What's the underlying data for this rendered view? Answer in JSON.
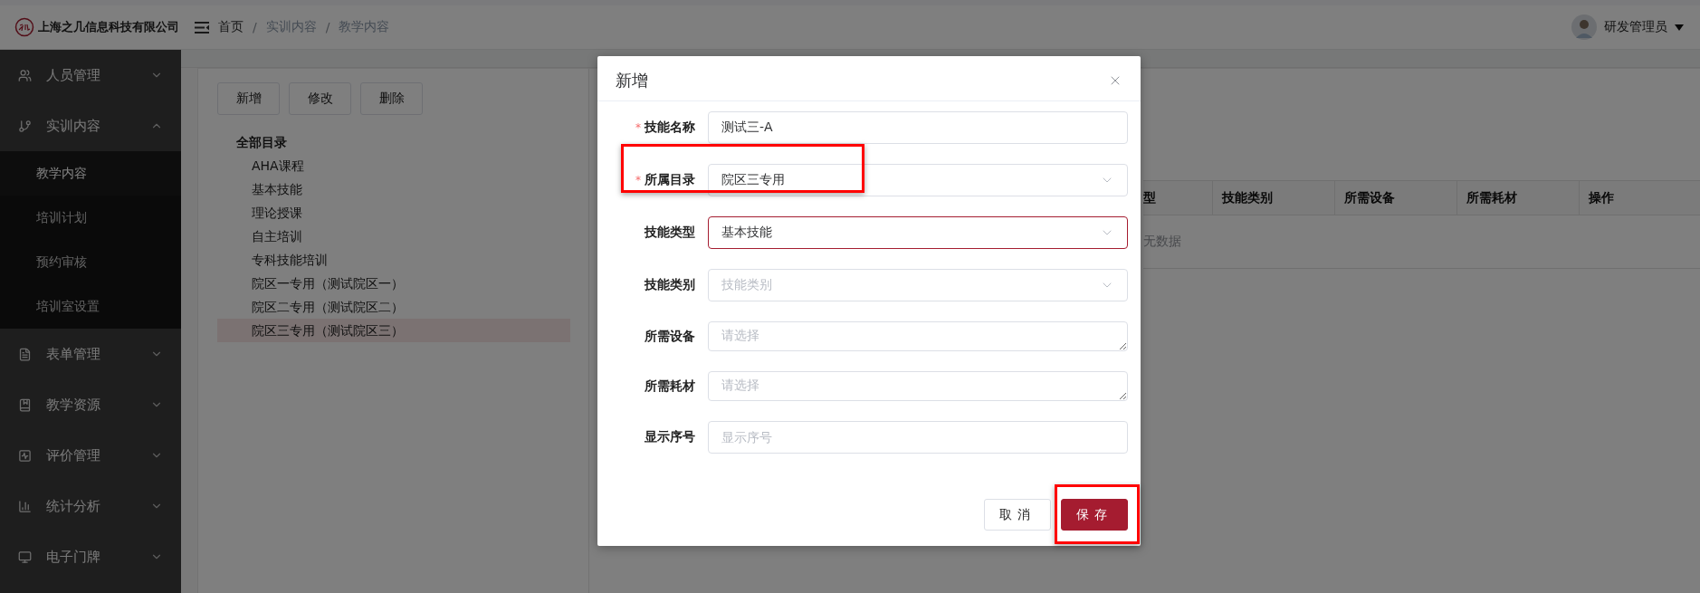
{
  "header": {
    "company": "上海之几信息科技有限公司",
    "breadcrumb": [
      {
        "kind": "link",
        "label": "首页"
      },
      {
        "kind": "separator",
        "label": "/"
      },
      {
        "kind": "current",
        "label": "实训内容"
      },
      {
        "kind": "separator",
        "label": "/"
      },
      {
        "kind": "current",
        "label": "教学内容"
      }
    ],
    "user": "研发管理员"
  },
  "sidebar": {
    "items": [
      {
        "label": "人员管理",
        "expanded": false
      },
      {
        "label": "实训内容",
        "expanded": true,
        "children": [
          {
            "label": "教学内容",
            "selected": true
          },
          {
            "label": "培训计划",
            "selected": false
          },
          {
            "label": "预约审核",
            "selected": false
          },
          {
            "label": "培训室设置",
            "selected": false
          }
        ]
      },
      {
        "label": "表单管理",
        "expanded": false
      },
      {
        "label": "教学资源",
        "expanded": false
      },
      {
        "label": "评价管理",
        "expanded": false
      },
      {
        "label": "统计分析",
        "expanded": false
      },
      {
        "label": "电子门牌",
        "expanded": false
      }
    ]
  },
  "toolbar": {
    "buttons": [
      "新增",
      "修改",
      "删除"
    ]
  },
  "tree": {
    "label": "全部目录",
    "children": [
      {
        "label": "AHA课程",
        "selected": false
      },
      {
        "label": "基本技能",
        "selected": false
      },
      {
        "label": "理论授课",
        "selected": false
      },
      {
        "label": "自主培训",
        "selected": false
      },
      {
        "label": "专科技能培训",
        "selected": false
      },
      {
        "label": "院区一专用（测试院区一）",
        "selected": false
      },
      {
        "label": "院区二专用（测试院区二）",
        "selected": false
      },
      {
        "label": "院区三专用（测试院区三）",
        "selected": true
      }
    ]
  },
  "table": {
    "columns": [
      "型",
      "技能类别",
      "所需设备",
      "所需耗材",
      "操作"
    ],
    "empty_text": "无数据"
  },
  "dialog": {
    "title": "新增",
    "fields": [
      {
        "label": "技能名称",
        "kind": "input",
        "marker": "*",
        "value": "测试三-A",
        "focused": false,
        "highlighted": false
      },
      {
        "label": "所属目录",
        "kind": "select",
        "marker": "*",
        "value": "院区三专用",
        "focused": false,
        "highlighted": true
      },
      {
        "label": "技能类型",
        "kind": "select",
        "value": "基本技能",
        "focused": true,
        "highlighted": false
      },
      {
        "label": "技能类别",
        "kind": "select",
        "placeholder": "技能类别",
        "focused": false,
        "highlighted": false
      },
      {
        "label": "所需设备",
        "kind": "textarea",
        "placeholder": "请选择",
        "focused": false,
        "highlighted": false
      },
      {
        "label": "所需耗材",
        "kind": "textarea",
        "placeholder": "请选择",
        "focused": false,
        "highlighted": false
      },
      {
        "label": "显示序号",
        "kind": "input",
        "placeholder": "显示序号",
        "focused": false,
        "highlighted": false
      }
    ],
    "buttons": [
      {
        "label": "取消",
        "kind": "default",
        "highlighted": false
      },
      {
        "label": "保存",
        "kind": "primary",
        "highlighted": true
      }
    ]
  }
}
